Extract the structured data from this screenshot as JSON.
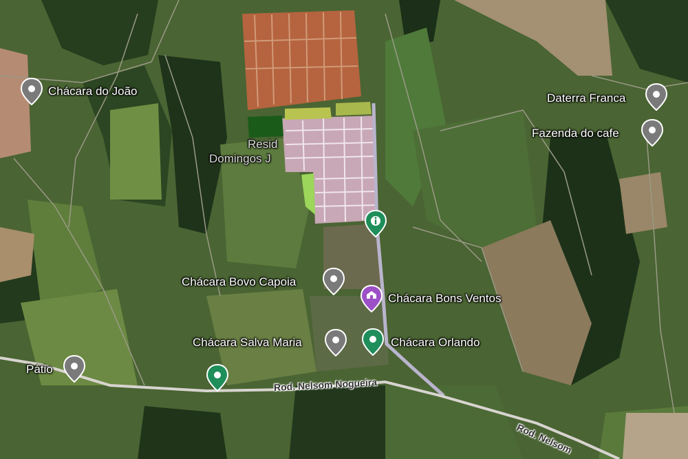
{
  "places": [
    {
      "name": "Chácara do João",
      "icon": "gray-pin-icon"
    },
    {
      "name": "Daterra Franca",
      "icon": "gray-pin-icon"
    },
    {
      "name": "Fazenda do cafe",
      "icon": "gray-pin-icon"
    },
    {
      "name": "Chácara Bovo Capoia",
      "icon": "gray-pin-icon"
    },
    {
      "name": "Chácara Bons Ventos",
      "icon": "purple-pin-icon"
    },
    {
      "name": "Chácara Salva Maria",
      "icon": "gray-pin-icon"
    },
    {
      "name": "Chácara Orlando",
      "icon": "green-pin-icon"
    },
    {
      "name": "Pátio",
      "icon": "gray-pin-icon"
    }
  ],
  "faded_labels": [
    "Resid",
    "Domingos J"
  ],
  "roads": [
    "Rod. Nelsom Nogueira",
    "Rod. Nelsom"
  ],
  "extra_pins": [
    "green-info-pin-icon",
    "green-pin-icon"
  ],
  "colors": {
    "gray_pin": "#7a7a7a",
    "purple_pin": "#9c4fc7",
    "green_pin": "#1e8e5a",
    "road": "#b9b4cc"
  }
}
